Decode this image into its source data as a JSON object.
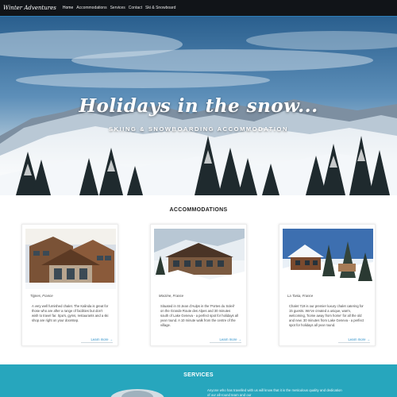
{
  "nav": {
    "brand": "Winter Adventures",
    "links": [
      "Home",
      "Accommodations",
      "Services",
      "Contact",
      "Ski & Snowboard"
    ]
  },
  "hero": {
    "title": "Holidays in the snow...",
    "subtitle": "SKIING & SNOWBOARDING ACCOMMODATION"
  },
  "accommodations": {
    "title": "ACCOMMODATIONS",
    "cards": [
      {
        "location": "Tignes, France",
        "description": "A very well furnished chalet. The Kalinda is great for those who are after a range of facilities but don't wish to travel far. Spa's, gyms, restaurants and a ski shop are right on your doorstep.",
        "link": "Learn more →"
      },
      {
        "location": "Morzine, France",
        "description": "Situated in St Jean d'Aulps in the 'Portes du Soleil' on the Grande Route des Alpes and 30 minutes south of Lake Geneva - a perfect spot for holidays all year round. A 10 minute walk from the centre of the village.",
        "link": "Learn more →"
      },
      {
        "location": "La Tania, France",
        "description": "Chalet 719 is our premier luxury chalet catering for 15 guests. We've created a unique, warm, welcoming, 'home away from home' for all the old and new. 30 minutes from Lake Geneva - a perfect spot for holidays all year round.",
        "link": "Learn more →"
      }
    ]
  },
  "services": {
    "title": "SERVICES",
    "text": "Anyone who has travelled with us will know that it is the meticulous quality and dedication of our all-round team and our"
  },
  "colors": {
    "nav_bg": "#111418",
    "accent": "#2b8fc9",
    "services_bg": "#27a6bd"
  }
}
